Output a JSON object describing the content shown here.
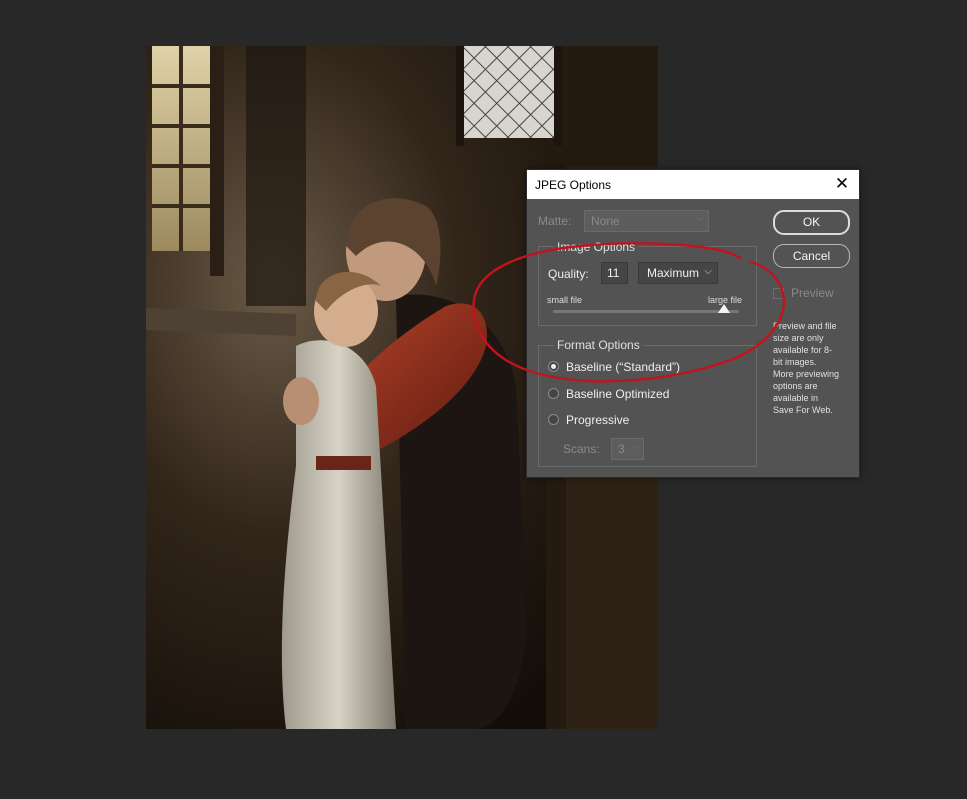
{
  "dialog": {
    "title": "JPEG Options",
    "matte": {
      "label": "Matte:",
      "value": "None"
    },
    "image_options": {
      "title": "Image Options",
      "quality_label": "Quality:",
      "quality_value": "11",
      "quality_preset": "Maximum",
      "slider_min_label": "small file",
      "slider_max_label": "large file",
      "slider_level": 11,
      "slider_max": 12
    },
    "format_options": {
      "title": "Format Options",
      "options": [
        {
          "label": "Baseline (“Standard”)",
          "checked": true
        },
        {
          "label": "Baseline Optimized",
          "checked": false
        },
        {
          "label": "Progressive",
          "checked": false
        }
      ],
      "scans_label": "Scans:",
      "scans_value": "3"
    },
    "buttons": {
      "ok": "OK",
      "cancel": "Cancel"
    },
    "preview_label": "Preview",
    "note_lines": [
      "Preview and file",
      "size are only",
      "available for 8-",
      "bit images.",
      "More previewing",
      "options are",
      "available in",
      "Save For Web."
    ]
  },
  "colors": {
    "app_background": "#282828",
    "dialog_background": "#535353",
    "annotation_stroke": "#c0141e"
  },
  "icons": {
    "close": "close-icon",
    "dropdown": "chevron-down-icon"
  }
}
